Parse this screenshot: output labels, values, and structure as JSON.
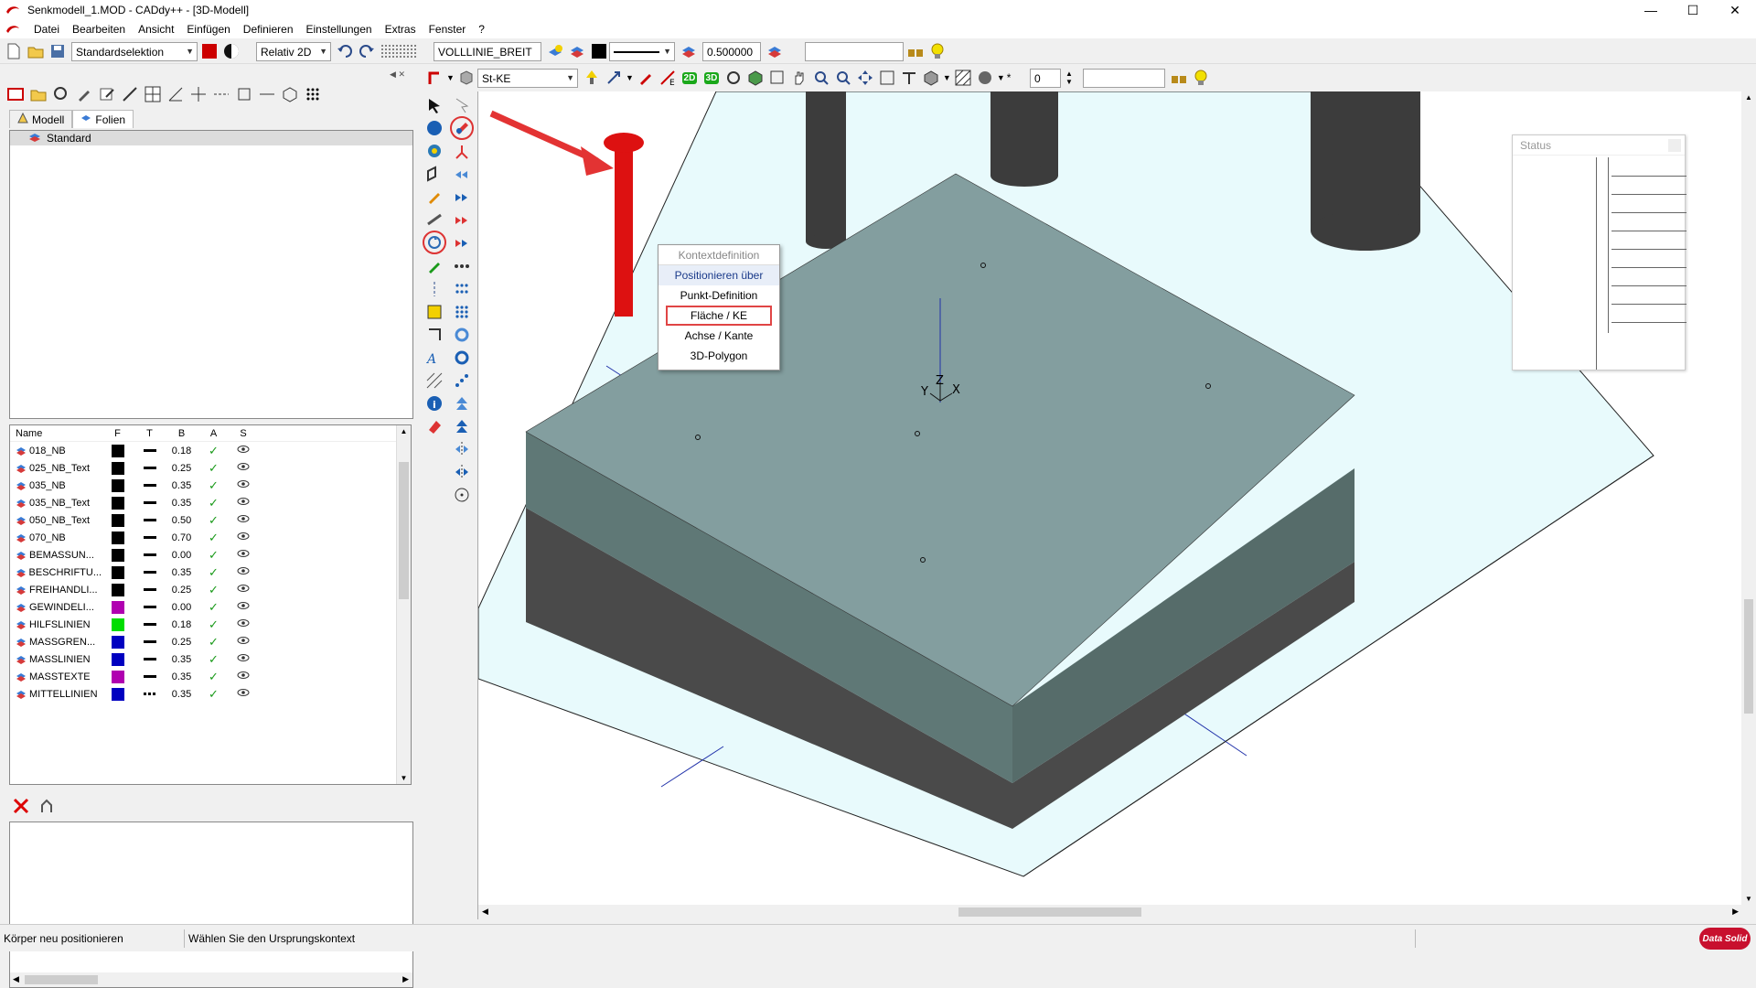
{
  "titlebar": {
    "title": "Senkmodell_1.MOD  -  CADdy++ - [3D-Modell]"
  },
  "menu": [
    "Datei",
    "Bearbeiten",
    "Ansicht",
    "Einfügen",
    "Definieren",
    "Einstellungen",
    "Extras",
    "Fenster",
    "?"
  ],
  "toolbar1": {
    "selection_mode": "Standardselektion",
    "coord_mode": "Relativ 2D",
    "linetype": "VOLLLINIE_BREIT",
    "line_width": "0.500000",
    "empty_field": ""
  },
  "toolbar2": {
    "layer_combo": "St-KE",
    "btn_2d": "2D",
    "btn_3d": "3D",
    "step_value": "0",
    "empty_field": ""
  },
  "left_panel": {
    "tabs": [
      "Modell",
      "Folien"
    ],
    "active_tab": "Folien",
    "layer_group": "Standard",
    "table_headers": [
      "Name",
      "F",
      "T",
      "B",
      "A",
      "S"
    ],
    "rows": [
      {
        "name": "018_NB",
        "color": "#000000",
        "width": "0.18",
        "dash": false
      },
      {
        "name": "025_NB_Text",
        "color": "#000000",
        "width": "0.25",
        "dash": false
      },
      {
        "name": "035_NB",
        "color": "#000000",
        "width": "0.35",
        "dash": false
      },
      {
        "name": "035_NB_Text",
        "color": "#000000",
        "width": "0.35",
        "dash": false
      },
      {
        "name": "050_NB_Text",
        "color": "#000000",
        "width": "0.50",
        "dash": false
      },
      {
        "name": "070_NB",
        "color": "#000000",
        "width": "0.70",
        "dash": false
      },
      {
        "name": "BEMASSUN...",
        "color": "#000000",
        "width": "0.00",
        "dash": false
      },
      {
        "name": "BESCHRIFTU...",
        "color": "#000000",
        "width": "0.35",
        "dash": false
      },
      {
        "name": "FREIHANDLI...",
        "color": "#000000",
        "width": "0.25",
        "dash": false
      },
      {
        "name": "GEWINDELI...",
        "color": "#b000b0",
        "width": "0.00",
        "dash": false
      },
      {
        "name": "HILFSLINIEN",
        "color": "#00dd00",
        "width": "0.18",
        "dash": false
      },
      {
        "name": "MASSGREN...",
        "color": "#0000c0",
        "width": "0.25",
        "dash": false
      },
      {
        "name": "MASSLINIEN",
        "color": "#0000c0",
        "width": "0.35",
        "dash": false
      },
      {
        "name": "MASSTEXTE",
        "color": "#b000b0",
        "width": "0.35",
        "dash": false
      },
      {
        "name": "MITTELLINIEN",
        "color": "#0000c0",
        "width": "0.35",
        "dash": true
      }
    ]
  },
  "context_menu": {
    "title": "Kontextdefinition",
    "items": [
      "Positionieren über",
      "Punkt-Definition",
      "Fläche / KE",
      "Achse / Kante",
      "3D-Polygon"
    ],
    "highlighted": "Fläche / KE"
  },
  "status_panel": {
    "title": "Status"
  },
  "viewport": {
    "axis_labels": {
      "x": "X",
      "y": "Y",
      "z": "Z"
    },
    "slab_top_color": "#839e9f",
    "slab_side_color": "#5f7876",
    "slab_base_color": "#4a4a4a",
    "plane_color": "#e8fafc",
    "pin_color": "#dd1111"
  },
  "statusbar": {
    "left": "Körper neu positionieren",
    "right": "Wählen Sie den Ursprungskontext",
    "logo": "Data Solid"
  }
}
